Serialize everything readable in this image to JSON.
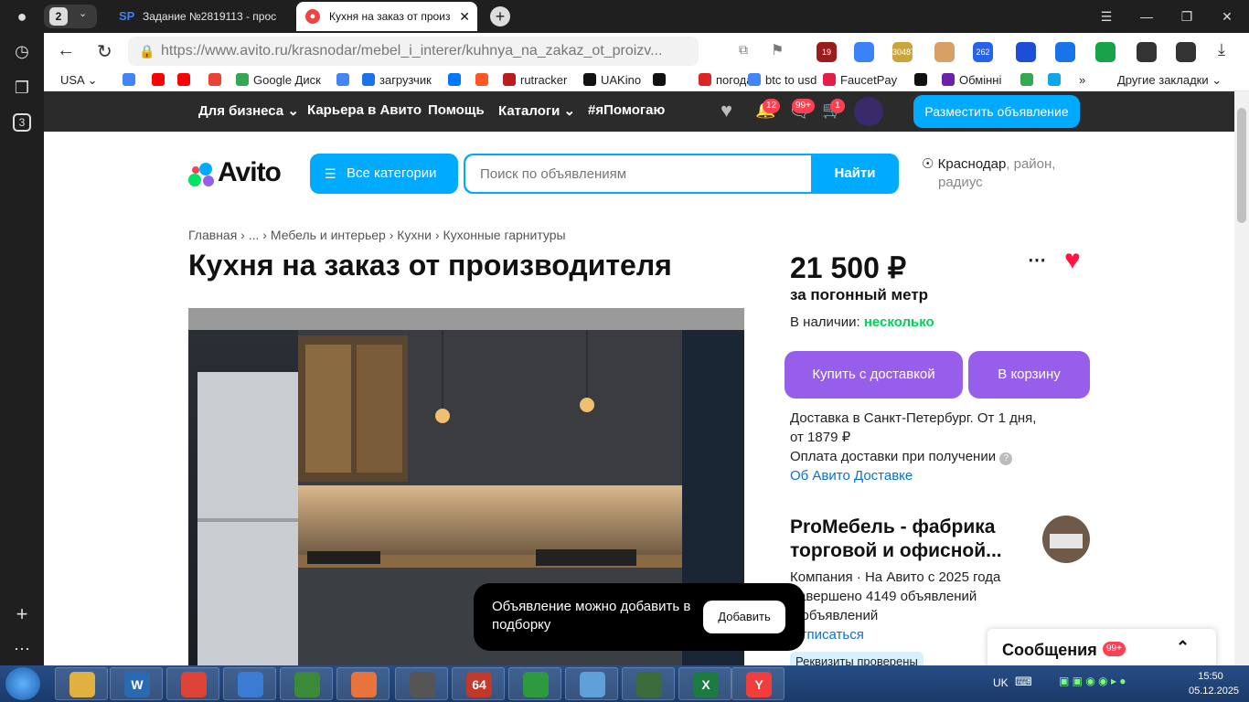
{
  "browser": {
    "tab_counter": "2",
    "tabs": [
      {
        "label": "Задание №2819113 - прос",
        "favicon": "SP",
        "color": "#3b82f6"
      },
      {
        "label": "Кухня на заказ от произ",
        "favicon": "●",
        "color": "#ef4444"
      }
    ],
    "url_domain": "https://www.avito.ru/",
    "url_path": "krasnodar/mebel_i_interer/kuhnya_na_zakaz_ot_proizv...",
    "sidebar_counter": "3",
    "extensions": [
      {
        "label": "19",
        "color": "#9b1c1c"
      },
      {
        "label": "",
        "color": "#3b82f6"
      },
      {
        "label": "30487",
        "color": "#caa53b"
      },
      {
        "label": "",
        "color": "#d9a066"
      },
      {
        "label": "262",
        "color": "#2563eb"
      },
      {
        "label": "",
        "color": "#1d4ed8"
      },
      {
        "label": "",
        "color": "#1a73e8"
      },
      {
        "label": "",
        "color": "#16a34a"
      },
      {
        "label": "",
        "color": "#333333"
      },
      {
        "label": "",
        "color": "#333333"
      }
    ],
    "bookmarks": [
      {
        "label": "USA",
        "color": "#ffffff"
      },
      {
        "label": "",
        "color": "#4285f4"
      },
      {
        "label": "",
        "color": "#ff0000"
      },
      {
        "label": "",
        "color": "#ff0000"
      },
      {
        "label": "",
        "color": "#ea4335"
      },
      {
        "label": "Google Диск",
        "color": "#34a853"
      },
      {
        "label": "",
        "color": "#4285f4"
      },
      {
        "label": "загрузчик",
        "color": "#1a73e8"
      },
      {
        "label": "",
        "color": "#0077ff"
      },
      {
        "label": "",
        "color": "#ff5722"
      },
      {
        "label": "rutracker",
        "color": "#b91c1c"
      },
      {
        "label": "UAKino",
        "color": "#111111"
      },
      {
        "label": "",
        "color": "#111111"
      },
      {
        "label": "погода",
        "color": "#dc2626"
      },
      {
        "label": "btc to usd",
        "color": "#4285f4"
      },
      {
        "label": "FaucetPay",
        "color": "#e11d48"
      },
      {
        "label": "",
        "color": "#111111"
      },
      {
        "label": "Обмінні",
        "color": "#6b21a8"
      },
      {
        "label": "",
        "color": "#34a853"
      },
      {
        "label": "",
        "color": "#0ea5e9"
      }
    ],
    "bookmarks_more": "»",
    "other_bookmarks": "Другие закладки"
  },
  "avito_top": {
    "for_business": "Для бизнеса",
    "career": "Карьера в Авито",
    "help": "Помощь",
    "catalogs": "Каталоги",
    "help_tag": "#яПомогаю",
    "notif_badge": "12",
    "msg_badge": "99+",
    "cart_badge": "1",
    "post_ad": "Разместить объявление"
  },
  "header": {
    "logo": "Avito",
    "all_categories": "Все категории",
    "search_placeholder": "Поиск по объявлениям",
    "search_button": "Найти",
    "city": "Краснодар",
    "location_hint": ", район,",
    "location_hint2": "радиус"
  },
  "breadcrumbs": [
    "Главная",
    "...",
    "Мебель и интерьер",
    "Кухни",
    "Кухонные гарнитуры"
  ],
  "listing": {
    "title": "Кухня на заказ от производителя",
    "price": "21 500 ₽",
    "price_unit": "за погонный метр",
    "stock_label": "В наличии:",
    "stock_value": "несколько",
    "buy_button": "Купить с доставкой",
    "cart_button": "В корзину",
    "delivery_line1": "Доставка в Санкт-Петербург. От 1 дня,",
    "delivery_line2": "от 1879 ₽",
    "delivery_line3": "Оплата доставки при получении",
    "delivery_link": "Об Авито Доставке"
  },
  "seller": {
    "name_line1": "ProМебель - фабрика",
    "name_line2": "торговой и офисной...",
    "meta_line1": "Компания · На Авито с 2025 года",
    "meta_line2": "Завершено 4149 объявлений",
    "meta_line3": "6 объявлений",
    "unsubscribe": "Отписаться",
    "verified": "Реквизиты проверены"
  },
  "toast": {
    "text": "Объявление можно добавить в подборку",
    "button": "Добавить"
  },
  "messages": {
    "title": "Сообщения",
    "badge": "99+"
  },
  "taskbar": {
    "lang": "UK",
    "time": "15:50",
    "date": "05.12.2025",
    "apps": [
      {
        "label": "",
        "color": "#e0b040"
      },
      {
        "label": "W",
        "color": "#2a6ab0"
      },
      {
        "label": "",
        "color": "#db4437"
      },
      {
        "label": "",
        "color": "#3b7bd4"
      },
      {
        "label": "",
        "color": "#3a8a3a"
      },
      {
        "label": "",
        "color": "#e8743b"
      },
      {
        "label": "",
        "color": "#555555"
      },
      {
        "label": "64",
        "color": "#c0392b"
      },
      {
        "label": "",
        "color": "#2e9a3e"
      },
      {
        "label": "",
        "color": "#5fa0d8"
      },
      {
        "label": "",
        "color": "#3b6b3b"
      },
      {
        "label": "X",
        "color": "#1d7a43"
      },
      {
        "label": "Y",
        "color": "#f23d3d"
      }
    ]
  }
}
